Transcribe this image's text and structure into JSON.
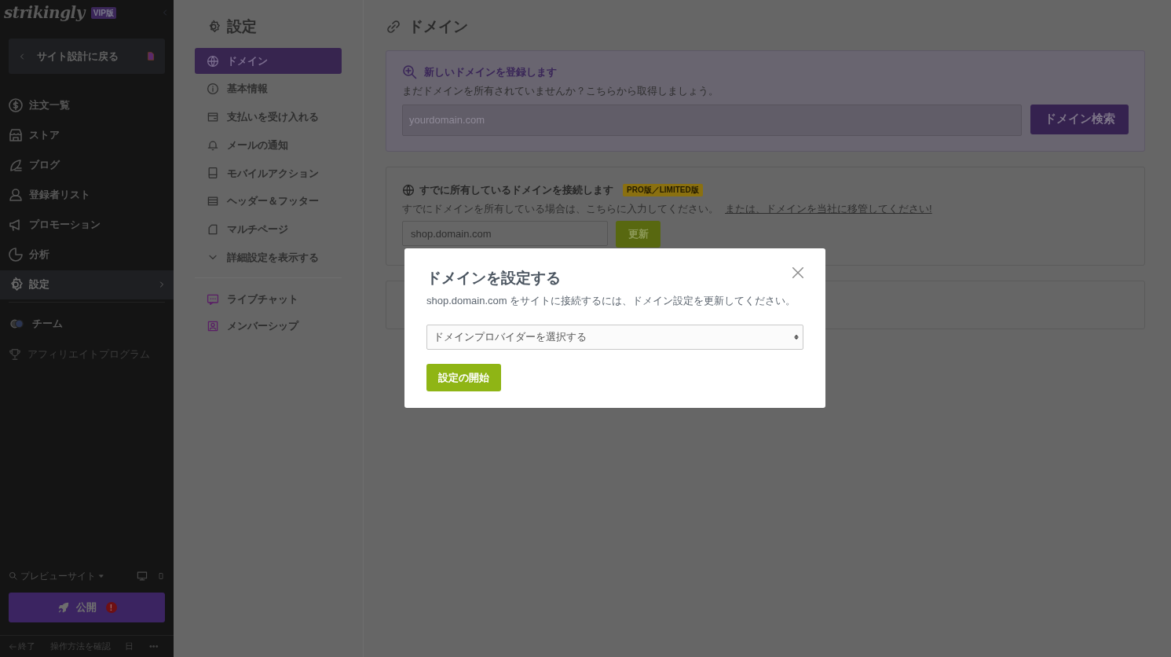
{
  "sidebar": {
    "logo": "strikingly",
    "plan_badge": "VIP版",
    "back_button": "サイト設計に戻る",
    "items": [
      {
        "label": "注文一覧",
        "selected": false
      },
      {
        "label": "ストア",
        "selected": false
      },
      {
        "label": "ブログ",
        "selected": false
      },
      {
        "label": "登録者リスト",
        "selected": false
      },
      {
        "label": "プロモーション",
        "selected": false
      },
      {
        "label": "分析",
        "selected": false
      },
      {
        "label": "設定",
        "selected": true
      }
    ],
    "extra_items": [
      {
        "label": "チーム",
        "disabled": false
      },
      {
        "label": "アフィリエイトプログラム",
        "disabled": true
      }
    ],
    "preview": "プレビューサイト",
    "publish_button": "公開",
    "publish_alert": "!",
    "footer": {
      "exit": "終了",
      "help": "操作方法を確認",
      "language": "日",
      "more": "•••"
    }
  },
  "settings_nav": {
    "title": "設定",
    "items": [
      {
        "label": "ドメイン",
        "selected": true,
        "kind": "page"
      },
      {
        "label": "基本情報",
        "selected": false,
        "kind": "page"
      },
      {
        "label": "支払いを受け入れる",
        "selected": false,
        "kind": "page"
      },
      {
        "label": "メールの通知",
        "selected": false,
        "kind": "page"
      },
      {
        "label": "モバイルアクション",
        "selected": false,
        "kind": "page"
      },
      {
        "label": "ヘッダー＆フッター",
        "selected": false,
        "kind": "page"
      },
      {
        "label": "マルチページ",
        "selected": false,
        "kind": "page"
      },
      {
        "label": "詳細設定を表示する",
        "selected": false,
        "kind": "expander"
      }
    ],
    "apps": [
      {
        "label": "ライブチャット"
      },
      {
        "label": "メンバーシップ"
      }
    ]
  },
  "main": {
    "title": "ドメイン",
    "register_card": {
      "title": "新しいドメインを登録します",
      "description": "まだドメインを所有されていませんか？こちらから取得しましょう。",
      "placeholder": "yourdomain.com",
      "button": "ドメイン検索"
    },
    "connect_card": {
      "title": "すでに所有しているドメインを接続します",
      "badge": "PRO版／LIMITED版",
      "description": "すでにドメインを所有している場合は、こちらに入力してください。",
      "link": "または、ドメインを当社に移管してください!",
      "value": "shop.domain.com",
      "button": "更新"
    }
  },
  "modal": {
    "title": "ドメインを設定する",
    "message": "shop.domain.com をサイトに接続するには、ドメイン設定を更新してください。",
    "select": "ドメインプロバイダーを選択する",
    "button": "設定の開始"
  }
}
